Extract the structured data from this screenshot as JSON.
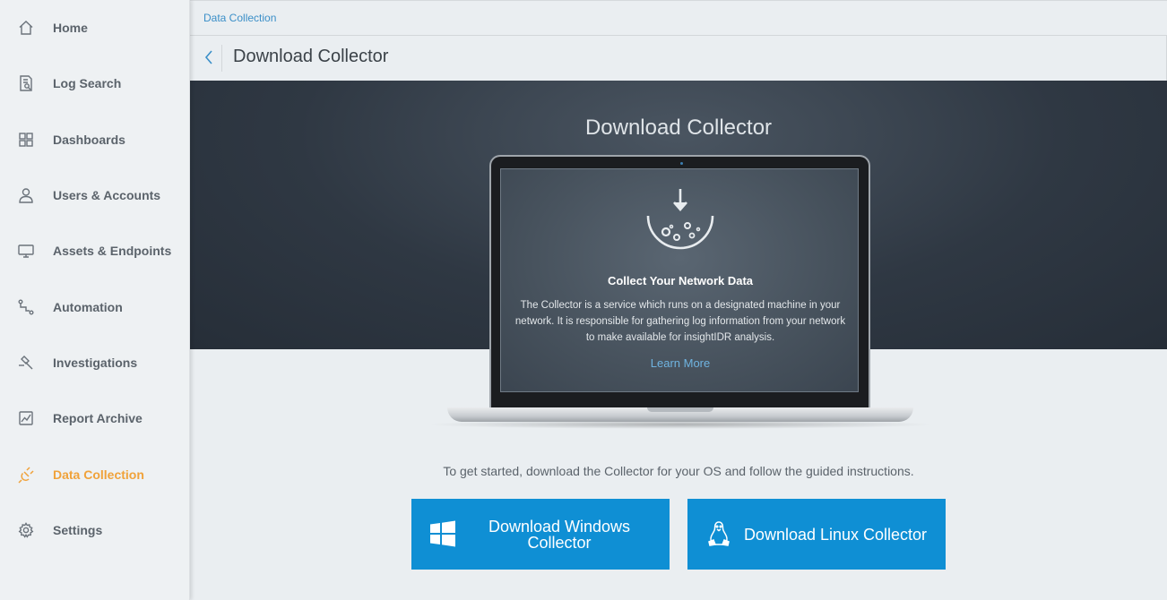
{
  "sidebar": {
    "items": [
      {
        "label": "Home",
        "icon": "home-icon"
      },
      {
        "label": "Log Search",
        "icon": "log-search-icon"
      },
      {
        "label": "Dashboards",
        "icon": "dashboards-icon"
      },
      {
        "label": "Users & Accounts",
        "icon": "user-icon"
      },
      {
        "label": "Assets & Endpoints",
        "icon": "monitor-icon"
      },
      {
        "label": "Automation",
        "icon": "automation-icon"
      },
      {
        "label": "Investigations",
        "icon": "gavel-icon"
      },
      {
        "label": "Report Archive",
        "icon": "chart-icon"
      },
      {
        "label": "Data Collection",
        "icon": "plug-icon",
        "active": true
      },
      {
        "label": "Settings",
        "icon": "gear-icon"
      }
    ],
    "active_color": "#f0a23a"
  },
  "header": {
    "breadcrumb": "Data Collection",
    "title": "Download Collector"
  },
  "hero": {
    "title": "Download Collector"
  },
  "screen": {
    "heading": "Collect Your Network Data",
    "body": "The Collector is a service which runs on a designated machine in your network. It is responsible for gathering log information from your network to make available for insightIDR analysis.",
    "link": "Learn More"
  },
  "instructions": "To get started, download the Collector for your OS and follow the guided instructions.",
  "buttons": {
    "windows": {
      "label_line1": "Download Windows",
      "label_line2": "Collector",
      "icon": "windows-icon"
    },
    "linux": {
      "label": "Download Linux Collector",
      "icon": "linux-icon"
    }
  },
  "colors": {
    "accent": "#0f8fd4",
    "link": "#3b8fc8"
  }
}
